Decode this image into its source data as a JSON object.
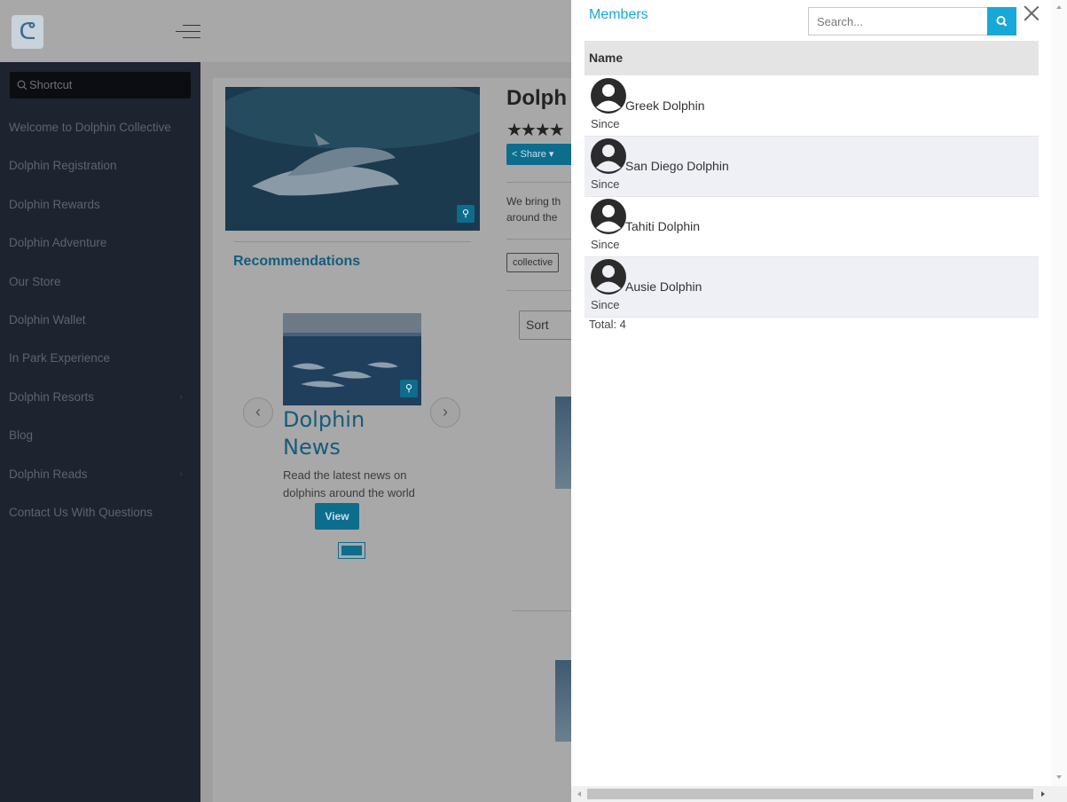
{
  "sidebar": {
    "logo_icon": "dolphin-logo-icon",
    "menu_icon": "hamburger-menu-icon",
    "shortcut_placeholder": "Shortcut",
    "items": [
      {
        "label": "Welcome to Dolphin Collective",
        "has_submenu": false
      },
      {
        "label": "Dolphin Registration",
        "has_submenu": false
      },
      {
        "label": "Dolphin Rewards",
        "has_submenu": false
      },
      {
        "label": "Dolphin Adventure",
        "has_submenu": false
      },
      {
        "label": "Our Store",
        "has_submenu": false
      },
      {
        "label": "Dolphin Wallet",
        "has_submenu": false
      },
      {
        "label": "In Park Experience",
        "has_submenu": false
      },
      {
        "label": "Dolphin Resorts",
        "has_submenu": true
      },
      {
        "label": "Blog",
        "has_submenu": false
      },
      {
        "label": "Dolphin Reads",
        "has_submenu": true
      },
      {
        "label": "Contact Us With Questions",
        "has_submenu": false
      }
    ],
    "submenu_chevron": "›"
  },
  "main": {
    "page_title": "Dolph",
    "stars": "★★★★",
    "share_label": "Share",
    "share_icon": "share-icon",
    "description_lines": [
      "We bring th",
      "around the"
    ],
    "tag": "collective",
    "sort_label": "Sort",
    "recommendations_title": "Recommendations",
    "carousel": {
      "item_title": "Dolphin News",
      "item_text": "Read the latest news on dolphins around the world",
      "view_label": "View",
      "prev_glyph": "‹",
      "next_glyph": "›"
    }
  },
  "members_panel": {
    "title": "Members",
    "search_placeholder": "Search...",
    "column_header": "Name",
    "members": [
      {
        "name": "Greek Dolphin",
        "since": "Since"
      },
      {
        "name": "San Diego Dolphin",
        "since": "Since"
      },
      {
        "name": "Tahiti Dolphin",
        "since": "Since"
      },
      {
        "name": "Ausie Dolphin",
        "since": "Since"
      }
    ],
    "total_text": "Total: 4"
  },
  "colors": {
    "accent": "#17a8d8",
    "sidebar_bg": "#1e2330",
    "dim_overlay": "#a8a8a8"
  }
}
